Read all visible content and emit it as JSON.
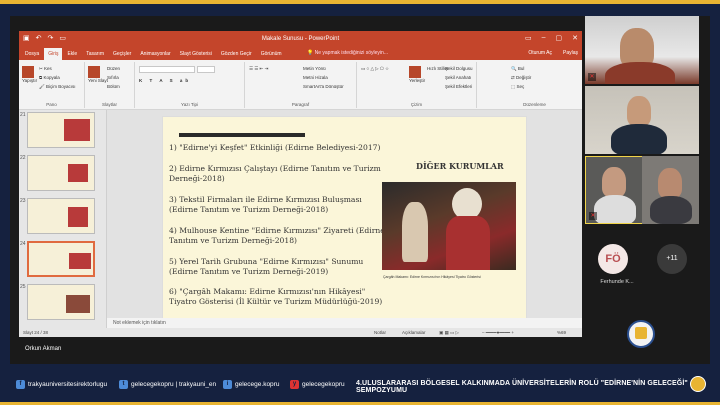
{
  "ppt": {
    "window_title": "Makale Sunusu - PowerPoint",
    "tabs": [
      "Dosya",
      "Giriş",
      "Ekle",
      "Tasarım",
      "Geçişler",
      "Animasyonlar",
      "Slayt Gösterisi",
      "Gözden Geçir",
      "Görünüm"
    ],
    "tell_me": "Ne yapmak istediğinizi söyleyin...",
    "sign_in": "Oturum Aç",
    "share": "Paylaş",
    "ribbon": {
      "paste": "Yapıştır",
      "cut": "Kes",
      "copy": "Kopyala",
      "format_painter": "Biçim Boyacısı",
      "clipboard_label": "Pano",
      "new_slide": "Yeni Slayt",
      "layout": "Düzen",
      "reset": "Sıfırla",
      "section": "Bölüm",
      "slides_label": "Slaytlar",
      "font_label": "Yazı Tipi",
      "text_direction": "Metin Yönü",
      "align_text": "Metni Hizala",
      "smartart": "SmartArt'a Dönüştür",
      "paragraph_label": "Paragraf",
      "arrange": "Yerleştir",
      "quick_styles": "Hızlı Stiller",
      "shape_fill": "Şekil Dolgusu",
      "shape_outline": "Şekil Anahatı",
      "shape_effects": "Şekil Efektleri",
      "drawing_label": "Çizim",
      "find": "Bul",
      "replace": "Değiştir",
      "select": "Seç",
      "editing_label": "Düzenleme"
    },
    "thumb_numbers": [
      "21",
      "22",
      "23",
      "24",
      "25"
    ],
    "slide": {
      "items": [
        "1) \"Edirne'yi Keşfet\" Etkinliği (Edirne Belediyesi-2017)",
        "2) Edirne Kırmızısı Çalıştayı (Edirne Tanıtım ve Turizm Derneği-2018)",
        "3) Tekstil Firmaları ile Edirne Kırmızısı Buluşması (Edirne Tanıtım ve Turizm Derneği-2018)",
        "4) Mulhouse Kentine \"Edirne Kırmızısı\" Ziyareti (Edirne Tanıtım ve Turizm Derneği-2018)",
        "5) Yerel Tarih Grubuna \"Edirne Kırmızısı\" Sunumu (Edirne Tanıtım ve Turizm Derneği-2019)",
        "6) \"Çargâh Makamı: Edirne Kırmızısı'nın Hikâyesi\" Tiyatro Gösterisi (İl Kültür ve Turizm Müdürlüğü-2019)"
      ],
      "heading": "DİĞER KURUMLAR",
      "caption": "Çargâh Makamı: Edirne Kırmızısı'nın Hikâyesi Tiyatro Gösterisi"
    },
    "notes_placeholder": "Not eklemek için tıklatın",
    "status": {
      "slide_counter": "Slayt 24 / 38",
      "notes": "Notlar",
      "comments": "Açıklamalar",
      "zoom": "%69"
    }
  },
  "zoom": {
    "presenter_name": "Orkun Akman",
    "avatar_initials": "FÖ",
    "avatar_name": "Ferhunde K...",
    "more_participants": "+11"
  },
  "footer": {
    "items": [
      {
        "icon": "f",
        "text": "trakyauniversitesirektorlugu"
      },
      {
        "icon": "t",
        "text": "gelecegekopru | trakyauni_en"
      },
      {
        "icon": "i",
        "text": "gelecege.kopru"
      },
      {
        "icon": "y",
        "text": "gelecegekopru"
      }
    ],
    "title": "4.ULUSLARARASI BÖLGESEL KALKINMADA ÜNİVERSİTELERİN ROLÜ \"EDİRNE'NİN GELECEĞİ\" SEMPOZYUMU"
  },
  "colors": {
    "ppt_accent": "#c4452b",
    "footer_bg": "#15213f",
    "gold": "#e8b432"
  }
}
